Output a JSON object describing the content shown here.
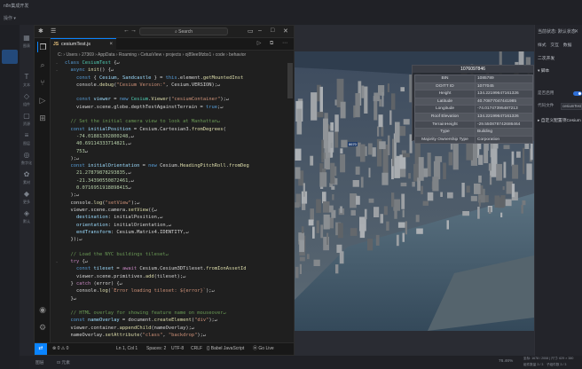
{
  "host": {
    "title": "n8n集成开发",
    "menu": "操作 ▾",
    "strip_labels": [
      "图表",
      "文本",
      "组件",
      "资源",
      "图层",
      "数字化",
      "素材",
      "更多",
      "默认"
    ],
    "bottom": {
      "left_a": "图层",
      "left_b": "⊡ 元素",
      "zoom": "76.46%",
      "coords": "坐标: 1678 / 2008 | 尺寸: 629 × 380",
      "items": "组件数量 3 / 3　子组件数 3 / 3"
    }
  },
  "vscode": {
    "search": "Search",
    "tab": {
      "label": "cesiumTest.js",
      "lang": "JS"
    },
    "breadcrumb": "C: › Users › 27369 › AppData › Roaming › CetusView › projects › oj89ee9fzbx1 › code › behavior",
    "status": {
      "errors": "⊗ 0 ⚠ 0",
      "position": "Ln 1, Col 1",
      "spaces": "Spaces: 2",
      "encoding": "UTF-8",
      "eol": "CRLF",
      "language": "{} Babel JavaScript",
      "golive": "⦿ Go Live"
    },
    "code_lines": [
      [
        [
          "kw",
          "class "
        ],
        [
          "cls",
          "CesiumTest "
        ],
        [
          "pl",
          "{↵"
        ]
      ],
      [
        [
          "pl",
          "  "
        ],
        [
          "kw",
          "async "
        ],
        [
          "fn",
          "init"
        ],
        [
          "pl",
          "() {↵"
        ]
      ],
      [
        [
          "pl",
          "    "
        ],
        [
          "kw",
          "const "
        ],
        [
          "pl",
          "{ "
        ],
        [
          "var",
          "Cesium"
        ],
        [
          "pl",
          ", "
        ],
        [
          "var",
          "Sandcastle"
        ],
        [
          "pl",
          " } = "
        ],
        [
          "kw",
          "this"
        ],
        [
          "pl",
          ".element."
        ],
        [
          "fn",
          "getMountedInst"
        ]
      ],
      [
        [
          "pl",
          "    console."
        ],
        [
          "fn",
          "debug"
        ],
        [
          "pl",
          "("
        ],
        [
          "str",
          "\"Cesium Version:\""
        ],
        [
          "pl",
          ", Cesium.VERSION);↵"
        ]
      ],
      [
        [
          "pl",
          ""
        ]
      ],
      [
        [
          "pl",
          "    "
        ],
        [
          "kw",
          "const "
        ],
        [
          "var",
          "viewer"
        ],
        [
          "pl",
          " = "
        ],
        [
          "kw",
          "new "
        ],
        [
          "cls",
          "Cesium"
        ],
        [
          "pl",
          "."
        ],
        [
          "fn",
          "Viewer"
        ],
        [
          "pl",
          "("
        ],
        [
          "str",
          "\"cesiumContainer\""
        ],
        [
          "pl",
          ");↵"
        ]
      ],
      [
        [
          "pl",
          "    viewer.scene.globe.depthTestAgainstTerrain = "
        ],
        [
          "kw",
          "true"
        ],
        [
          "pl",
          ";↵"
        ]
      ],
      [
        [
          "pl",
          ""
        ]
      ],
      [
        [
          "cm",
          "  // Set the initial camera view to look at Manhattan↵"
        ]
      ],
      [
        [
          "kw",
          "  const "
        ],
        [
          "var",
          "initialPosition"
        ],
        [
          "pl",
          " = Cesium.Cartesian3."
        ],
        [
          "fn",
          "fromDegrees"
        ],
        [
          "pl",
          "("
        ]
      ],
      [
        [
          "pl",
          "    "
        ],
        [
          "num",
          "-74.01881302800248"
        ],
        [
          "pl",
          ",↵"
        ]
      ],
      [
        [
          "pl",
          "    "
        ],
        [
          "num",
          "40.69114333714821"
        ],
        [
          "pl",
          ",↵"
        ]
      ],
      [
        [
          "pl",
          "    "
        ],
        [
          "num",
          "753"
        ],
        [
          "pl",
          "↵"
        ]
      ],
      [
        [
          "pl",
          "  );↵"
        ]
      ],
      [
        [
          "kw",
          "  const "
        ],
        [
          "var",
          "initialOrientation"
        ],
        [
          "pl",
          " = "
        ],
        [
          "kw",
          "new "
        ],
        [
          "pl",
          "Cesium."
        ],
        [
          "fn",
          "HeadingPitchRoll"
        ],
        [
          "pl",
          "."
        ],
        [
          "fn",
          "fromDeg"
        ]
      ],
      [
        [
          "pl",
          "    "
        ],
        [
          "num",
          "21.27879878293835"
        ],
        [
          "pl",
          ",↵"
        ]
      ],
      [
        [
          "pl",
          "    "
        ],
        [
          "num",
          "-21.34390550872461"
        ],
        [
          "pl",
          ",↵"
        ]
      ],
      [
        [
          "pl",
          "    "
        ],
        [
          "num",
          "0.0716951918898415"
        ],
        [
          "pl",
          "↵"
        ]
      ],
      [
        [
          "pl",
          "  );↵"
        ]
      ],
      [
        [
          "pl",
          "  console."
        ],
        [
          "fn",
          "log"
        ],
        [
          "pl",
          "("
        ],
        [
          "str",
          "\"setView\""
        ],
        [
          "pl",
          ");↵"
        ]
      ],
      [
        [
          "pl",
          "  viewer.scene.camera."
        ],
        [
          "fn",
          "setView"
        ],
        [
          "pl",
          "({↵"
        ]
      ],
      [
        [
          "pl",
          "    "
        ],
        [
          "var",
          "destination"
        ],
        [
          "pl",
          ": initialPosition,↵"
        ]
      ],
      [
        [
          "pl",
          "    "
        ],
        [
          "var",
          "orientation"
        ],
        [
          "pl",
          ": initialOrientation,↵"
        ]
      ],
      [
        [
          "pl",
          "    "
        ],
        [
          "var",
          "endTransform"
        ],
        [
          "pl",
          ": Cesium.Matrix4.IDENTITY,↵"
        ]
      ],
      [
        [
          "pl",
          "  });↵"
        ]
      ],
      [
        [
          "pl",
          ""
        ]
      ],
      [
        [
          "cm",
          "  // Load the NYC buildings tileset↵"
        ]
      ],
      [
        [
          "kw2",
          "  try "
        ],
        [
          "pl",
          "{↵"
        ]
      ],
      [
        [
          "kw",
          "    const "
        ],
        [
          "var",
          "tileset"
        ],
        [
          "pl",
          " = "
        ],
        [
          "kw2",
          "await "
        ],
        [
          "pl",
          "Cesium.Cesium3DTileset."
        ],
        [
          "fn",
          "fromIonAssetId"
        ]
      ],
      [
        [
          "pl",
          "    viewer.scene.primitives."
        ],
        [
          "fn",
          "add"
        ],
        [
          "pl",
          "(tileset);↵"
        ]
      ],
      [
        [
          "pl",
          "  } "
        ],
        [
          "kw2",
          "catch "
        ],
        [
          "pl",
          "(error) {↵"
        ]
      ],
      [
        [
          "pl",
          "    console."
        ],
        [
          "fn",
          "log"
        ],
        [
          "pl",
          "("
        ],
        [
          "str",
          "`Error loading tileset: ${error}`"
        ],
        [
          "pl",
          ");↵"
        ]
      ],
      [
        [
          "pl",
          "  }↵"
        ]
      ],
      [
        [
          "pl",
          ""
        ]
      ],
      [
        [
          "cm",
          "  // HTML overlay for showing feature name on mouseover↵"
        ]
      ],
      [
        [
          "kw",
          "  const "
        ],
        [
          "var",
          "nameOverlay"
        ],
        [
          "pl",
          " = document."
        ],
        [
          "fn",
          "createElement"
        ],
        [
          "pl",
          "("
        ],
        [
          "str",
          "\"div\""
        ],
        [
          "pl",
          ");↵"
        ]
      ],
      [
        [
          "pl",
          "  viewer.container."
        ],
        [
          "fn",
          "appendChild"
        ],
        [
          "pl",
          "(nameOverlay);↵"
        ]
      ],
      [
        [
          "pl",
          "  nameOverlay."
        ],
        [
          "fn",
          "setAttribute"
        ],
        [
          "pl",
          "("
        ],
        [
          "str",
          "\"class\""
        ],
        [
          "pl",
          ", "
        ],
        [
          "str",
          "\"backdrop\""
        ],
        [
          "pl",
          ");↵"
        ]
      ]
    ]
  },
  "popup": {
    "title": "1076097846",
    "rows": [
      [
        "BIN",
        "1085789"
      ],
      [
        "DOITT ID",
        "1077045"
      ],
      [
        "Height",
        "134.22199647161326"
      ],
      [
        "Latitude",
        "40.70877047441985"
      ],
      [
        "Longitude",
        "-74.01747395487213"
      ],
      [
        "Roof Elevation",
        "134.22199647161326"
      ],
      [
        "TerrainHeight",
        "-29.550878742686464"
      ],
      [
        "Type",
        "Building"
      ],
      [
        "Majority Ownership Type",
        "Corporation"
      ]
    ]
  },
  "marker": "8670",
  "rpanel": {
    "header": "当前状态: 默认状态",
    "tabs": "样式　交互　数据",
    "section1": "二次开发",
    "section2": "▾ 脚本",
    "row1": "是否启用",
    "row2_label": "代码文件",
    "row2_value": "cesiumTest.js",
    "section3": "▸ 自定义配置项Cesium"
  }
}
